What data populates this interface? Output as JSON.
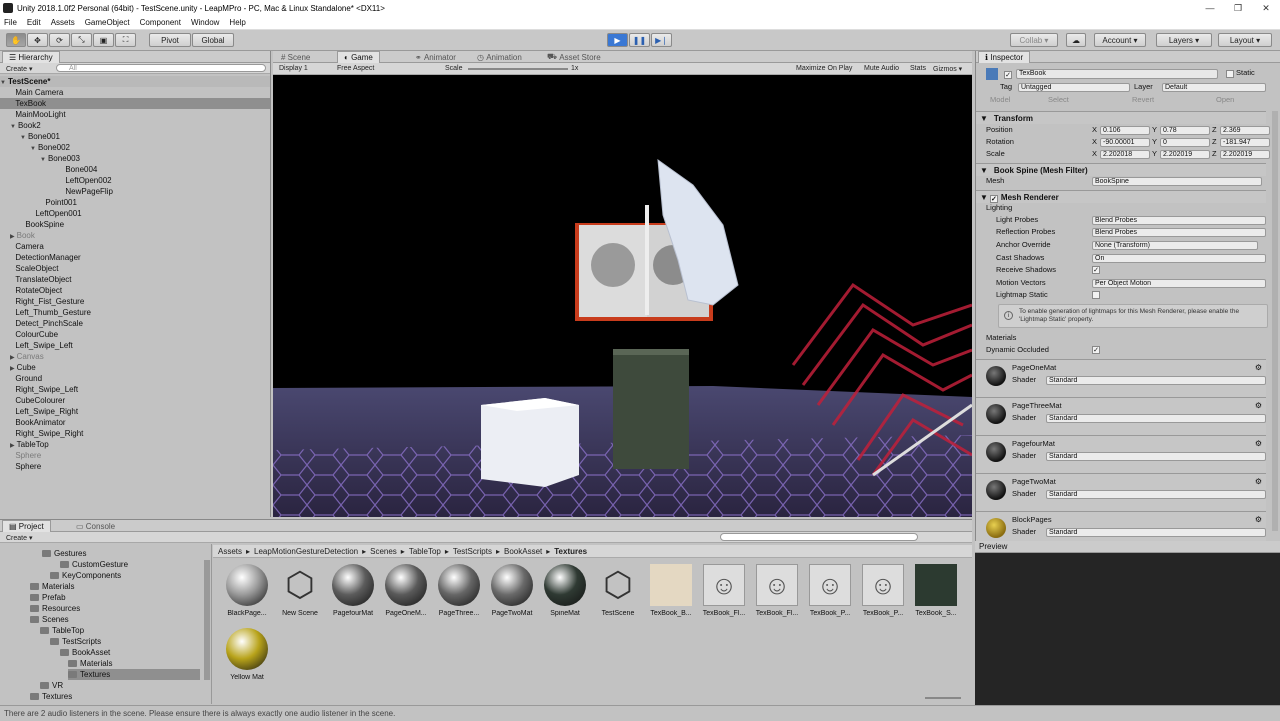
{
  "window": {
    "title": "Unity 2018.1.0f2 Personal (64bit) - TestScene.unity - LeapMPro - PC, Mac & Linux Standalone* <DX11>",
    "min": "—",
    "max": "❐",
    "close": "✕"
  },
  "menu": [
    "File",
    "Edit",
    "Assets",
    "GameObject",
    "Component",
    "Window",
    "Help"
  ],
  "toolbar": {
    "pivot": "Pivot",
    "global": "Global",
    "collab": "Collab ▾",
    "account": "Account",
    "layers": "Layers",
    "layout": "Layout",
    "tools": [
      "✋",
      "✥",
      "⟳",
      "⤡",
      "▣",
      "⛶"
    ]
  },
  "hierarchy": {
    "title": "Hierarchy",
    "create": "Create ▾",
    "search_placeholder": "All",
    "scene": "TestScene*",
    "items": [
      {
        "label": "Main Camera",
        "depth": 1,
        "gray": false,
        "sel": false,
        "tri": ""
      },
      {
        "label": "TexBook",
        "depth": 1,
        "gray": false,
        "sel": true,
        "tri": ""
      },
      {
        "label": "MainMooLight",
        "depth": 1,
        "gray": false,
        "sel": false,
        "tri": ""
      },
      {
        "label": "Book2",
        "depth": 1,
        "gray": false,
        "sel": false,
        "tri": "▼"
      },
      {
        "label": "Bone001",
        "depth": 2,
        "gray": false,
        "sel": false,
        "tri": "▼"
      },
      {
        "label": "Bone002",
        "depth": 3,
        "gray": false,
        "sel": false,
        "tri": "▼"
      },
      {
        "label": "Bone003",
        "depth": 4,
        "gray": false,
        "sel": false,
        "tri": "▼"
      },
      {
        "label": "Bone004",
        "depth": 6,
        "gray": false,
        "sel": false,
        "tri": ""
      },
      {
        "label": "LeftOpen002",
        "depth": 6,
        "gray": false,
        "sel": false,
        "tri": ""
      },
      {
        "label": "NewPageFlip",
        "depth": 6,
        "gray": false,
        "sel": false,
        "tri": ""
      },
      {
        "label": "Point001",
        "depth": 4,
        "gray": false,
        "sel": false,
        "tri": ""
      },
      {
        "label": "LeftOpen001",
        "depth": 3,
        "gray": false,
        "sel": false,
        "tri": ""
      },
      {
        "label": "BookSpine",
        "depth": 2,
        "gray": false,
        "sel": false,
        "tri": ""
      },
      {
        "label": "Book",
        "depth": 1,
        "gray": true,
        "sel": false,
        "tri": "▶"
      },
      {
        "label": "Camera",
        "depth": 1,
        "gray": false,
        "sel": false,
        "tri": ""
      },
      {
        "label": "DetectionManager",
        "depth": 1,
        "gray": false,
        "sel": false,
        "tri": ""
      },
      {
        "label": "ScaleObject",
        "depth": 1,
        "gray": false,
        "sel": false,
        "tri": ""
      },
      {
        "label": "TranslateObject",
        "depth": 1,
        "gray": false,
        "sel": false,
        "tri": ""
      },
      {
        "label": "RotateObject",
        "depth": 1,
        "gray": false,
        "sel": false,
        "tri": ""
      },
      {
        "label": "Right_Fist_Gesture",
        "depth": 1,
        "gray": false,
        "sel": false,
        "tri": ""
      },
      {
        "label": "Left_Thumb_Gesture",
        "depth": 1,
        "gray": false,
        "sel": false,
        "tri": ""
      },
      {
        "label": "Detect_PinchScale",
        "depth": 1,
        "gray": false,
        "sel": false,
        "tri": ""
      },
      {
        "label": "ColourCube",
        "depth": 1,
        "gray": false,
        "sel": false,
        "tri": ""
      },
      {
        "label": "Left_Swipe_Left",
        "depth": 1,
        "gray": false,
        "sel": false,
        "tri": ""
      },
      {
        "label": "Canvas",
        "depth": 1,
        "gray": true,
        "sel": false,
        "tri": "▶"
      },
      {
        "label": "Cube",
        "depth": 1,
        "gray": false,
        "sel": false,
        "tri": "▶"
      },
      {
        "label": "Ground",
        "depth": 1,
        "gray": false,
        "sel": false,
        "tri": ""
      },
      {
        "label": "Right_Swipe_Left",
        "depth": 1,
        "gray": false,
        "sel": false,
        "tri": ""
      },
      {
        "label": "CubeColourer",
        "depth": 1,
        "gray": false,
        "sel": false,
        "tri": ""
      },
      {
        "label": "Left_Swipe_Right",
        "depth": 1,
        "gray": false,
        "sel": false,
        "tri": ""
      },
      {
        "label": "BookAnimator",
        "depth": 1,
        "gray": false,
        "sel": false,
        "tri": ""
      },
      {
        "label": "Right_Swipe_Right",
        "depth": 1,
        "gray": false,
        "sel": false,
        "tri": ""
      },
      {
        "label": "TableTop",
        "depth": 1,
        "gray": false,
        "sel": false,
        "tri": "▶"
      },
      {
        "label": "Sphere",
        "depth": 1,
        "gray": true,
        "sel": false,
        "tri": ""
      },
      {
        "label": "Sphere",
        "depth": 1,
        "gray": false,
        "sel": false,
        "tri": ""
      }
    ]
  },
  "view_tabs": [
    "Scene",
    "Game",
    "Animator",
    "Animation",
    "Asset Store"
  ],
  "game": {
    "display": "Display 1",
    "aspect": "Free Aspect",
    "scale_label": "Scale",
    "scale_value": "1x",
    "maximize": "Maximize On Play",
    "mute": "Mute Audio",
    "stats": "Stats",
    "gizmos": "Gizmos ▾"
  },
  "inspector": {
    "title": "Inspector",
    "object": "TexBook",
    "static": "Static",
    "tag_label": "Tag",
    "tag": "Untagged",
    "layer_label": "Layer",
    "layer": "Default",
    "model": "Model",
    "select": "Select",
    "revert": "Revert",
    "open": "Open",
    "transform": {
      "title": "Transform",
      "position": "Position",
      "rotation": "Rotation",
      "scale": "Scale",
      "pos": [
        "0.106",
        "0.78",
        "2.369"
      ],
      "rot": [
        "-90.00001",
        "0",
        "-181.947"
      ],
      "scl": [
        "2.202018",
        "2.202019",
        "2.202019"
      ]
    },
    "meshfilter": {
      "title": "Book Spine (Mesh Filter)",
      "mesh_label": "Mesh",
      "mesh": "BookSpine"
    },
    "renderer": {
      "title": "Mesh Renderer",
      "lighting": "Lighting",
      "light_probes": "Light Probes",
      "light_probes_val": "Blend Probes",
      "refl": "Reflection Probes",
      "refl_val": "Blend Probes",
      "anchor": "Anchor Override",
      "anchor_val": "None (Transform)",
      "cast": "Cast Shadows",
      "cast_val": "On",
      "receive": "Receive Shadows",
      "motion": "Motion Vectors",
      "motion_val": "Per Object Motion",
      "lm_static": "Lightmap Static",
      "info": "To enable generation of lightmaps for this Mesh Renderer, please enable the 'Lightmap Static' property.",
      "materials": "Materials",
      "dyn": "Dynamic Occluded"
    },
    "mats": [
      {
        "name": "PageOneMat",
        "shader": "Standard"
      },
      {
        "name": "PageThreeMat",
        "shader": "Standard"
      },
      {
        "name": "PagefourMat",
        "shader": "Standard"
      },
      {
        "name": "PageTwoMat",
        "shader": "Standard"
      },
      {
        "name": "BlockPages",
        "shader": "Standard"
      }
    ],
    "shader_label": "Shader"
  },
  "preview": {
    "title": "Preview"
  },
  "project": {
    "tab_project": "Project",
    "tab_console": "Console",
    "create": "Create ▾",
    "tree": [
      {
        "label": "Gestures",
        "x": 42,
        "sel": false
      },
      {
        "label": "CustomGesture",
        "x": 60,
        "sel": false
      },
      {
        "label": "KeyComponents",
        "x": 50,
        "sel": false
      },
      {
        "label": "Materials",
        "x": 30,
        "sel": false
      },
      {
        "label": "Prefab",
        "x": 30,
        "sel": false
      },
      {
        "label": "Resources",
        "x": 30,
        "sel": false
      },
      {
        "label": "Scenes",
        "x": 30,
        "sel": false
      },
      {
        "label": "TableTop",
        "x": 40,
        "sel": false
      },
      {
        "label": "TestScripts",
        "x": 50,
        "sel": false
      },
      {
        "label": "BookAsset",
        "x": 60,
        "sel": false
      },
      {
        "label": "Materials",
        "x": 68,
        "sel": false
      },
      {
        "label": "Textures",
        "x": 68,
        "sel": true
      },
      {
        "label": "VR",
        "x": 40,
        "sel": false
      },
      {
        "label": "Textures",
        "x": 30,
        "sel": false
      }
    ],
    "breadcrumb": [
      "Assets",
      "LeapMotionGestureDetection",
      "Scenes",
      "TableTop",
      "TestScripts",
      "BookAsset",
      "Textures"
    ],
    "assets": [
      {
        "label": "BlackPage...",
        "kind": "ball",
        "color": "#9a9a9a"
      },
      {
        "label": "New Scene",
        "kind": "unity",
        "color": "#333"
      },
      {
        "label": "PagefourMat",
        "kind": "ball",
        "color": "#5c5c5c"
      },
      {
        "label": "PageOneM...",
        "kind": "ball",
        "color": "#5a5a5a"
      },
      {
        "label": "PageThree...",
        "kind": "ball",
        "color": "#666"
      },
      {
        "label": "PageTwoMat",
        "kind": "ball",
        "color": "#6a6a6a"
      },
      {
        "label": "SpineMat",
        "kind": "ball",
        "color": "#2f3a33"
      },
      {
        "label": "TestScene",
        "kind": "unity",
        "color": "#333"
      },
      {
        "label": "TexBook_B...",
        "kind": "tex",
        "color": "#e4d8c2"
      },
      {
        "label": "TexBook_Fl...",
        "kind": "face",
        "color": "#ddd"
      },
      {
        "label": "TexBook_Fl...",
        "kind": "face",
        "color": "#ddd"
      },
      {
        "label": "TexBook_P...",
        "kind": "face",
        "color": "#ddd"
      },
      {
        "label": "TexBook_P...",
        "kind": "face",
        "color": "#ddd"
      },
      {
        "label": "TexBook_S...",
        "kind": "tex",
        "color": "#2c3a30"
      },
      {
        "label": "Yellow Mat",
        "kind": "ball",
        "color": "#b8a31a"
      }
    ]
  },
  "status": "There are 2 audio listeners in the scene. Please ensure there is always exactly one audio listener in the scene."
}
